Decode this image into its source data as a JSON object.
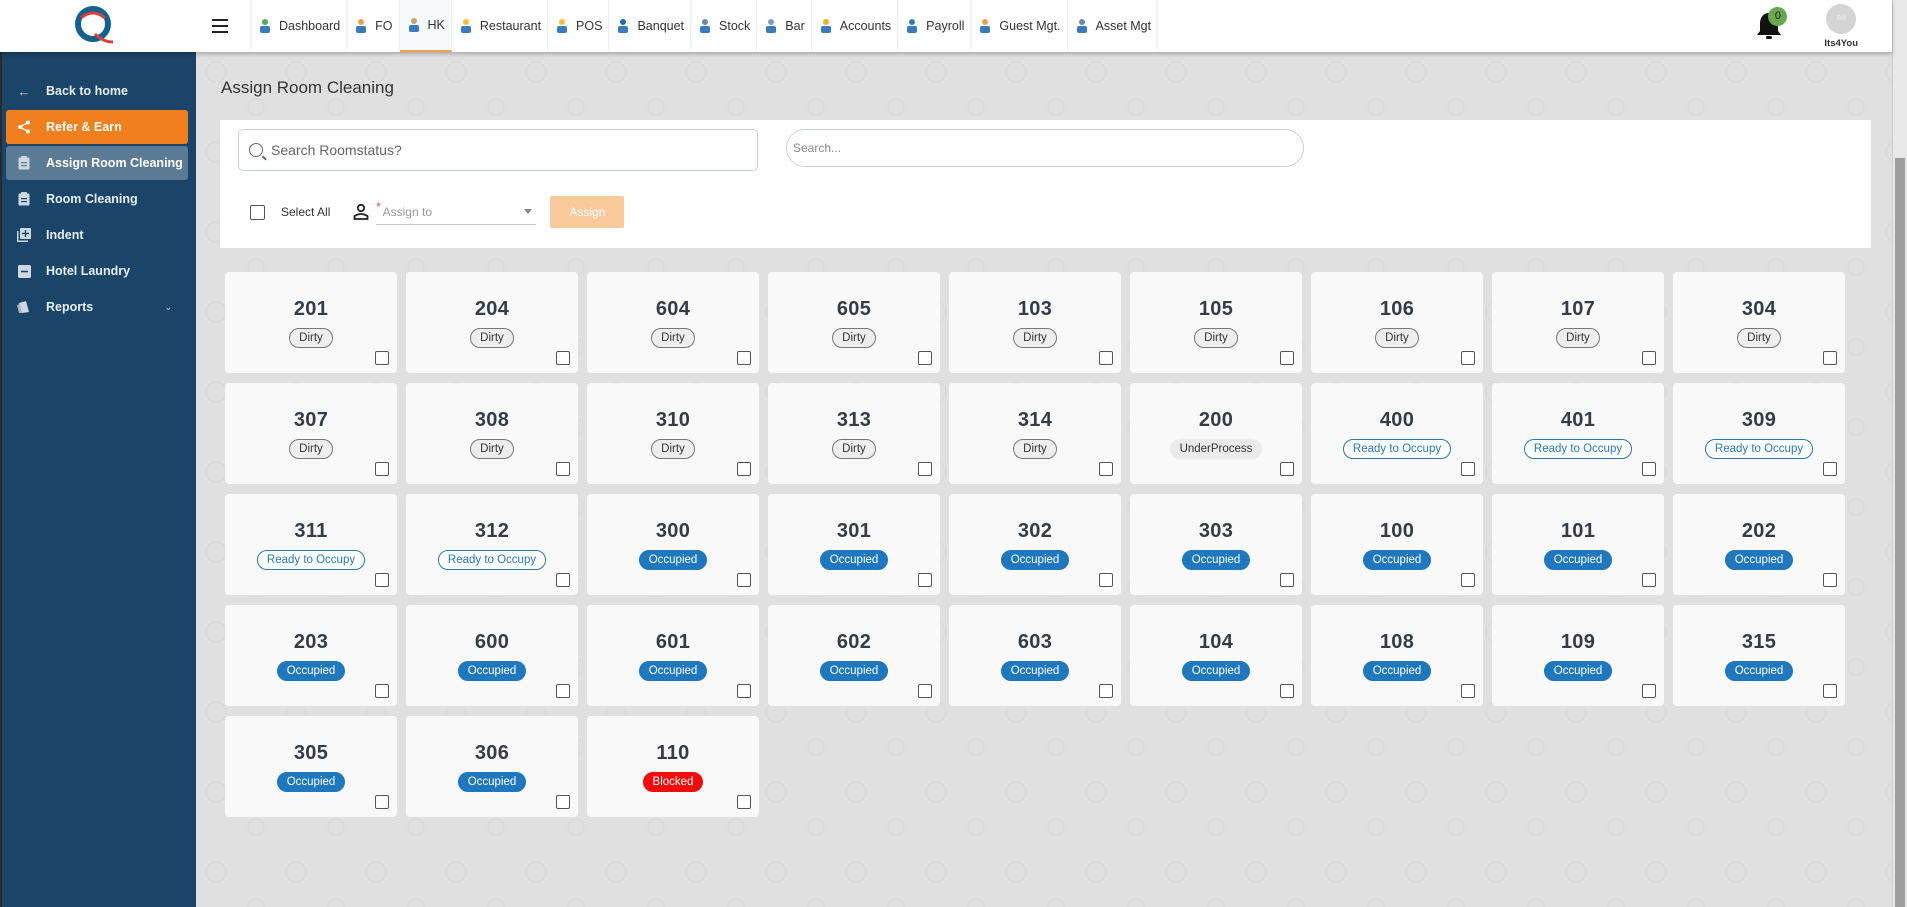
{
  "topbar": {
    "nav": [
      {
        "label": "Dashboard",
        "icon": "dashboard-icon"
      },
      {
        "label": "FO",
        "icon": "front-office-icon"
      },
      {
        "label": "HK",
        "icon": "housekeeping-icon",
        "active": true
      },
      {
        "label": "Restaurant",
        "icon": "restaurant-icon"
      },
      {
        "label": "POS",
        "icon": "pos-icon"
      },
      {
        "label": "Banquet",
        "icon": "banquet-icon"
      },
      {
        "label": "Stock",
        "icon": "stock-icon"
      },
      {
        "label": "Bar",
        "icon": "bar-icon"
      },
      {
        "label": "Accounts",
        "icon": "accounts-icon"
      },
      {
        "label": "Payroll",
        "icon": "payroll-icon"
      },
      {
        "label": "Guest Mgt.",
        "icon": "guest-mgt-icon"
      },
      {
        "label": "Asset Mgt",
        "icon": "asset-mgt-icon"
      }
    ],
    "notification_count": "0",
    "user_name": "Its4You",
    "avatar_text": "Bill"
  },
  "sidebar": {
    "items": [
      {
        "label": "Back to home",
        "icon": "arrow-left-icon"
      },
      {
        "label": "Refer & Earn",
        "icon": "share-icon"
      },
      {
        "label": "Assign Room Cleaning",
        "icon": "clipboard-icon"
      },
      {
        "label": "Room Cleaning",
        "icon": "clipboard-icon"
      },
      {
        "label": "Indent",
        "icon": "add-box-icon"
      },
      {
        "label": "Hotel Laundry",
        "icon": "minus-box-icon"
      },
      {
        "label": "Reports",
        "icon": "reports-icon"
      }
    ]
  },
  "main": {
    "title": "Assign Room Cleaning",
    "search_room_placeholder": "Search Roomstatus?",
    "search_placeholder": "Search...",
    "select_all_label": "Select All",
    "assign_to_placeholder": "Assign to",
    "required_mark": "*",
    "assign_button": "Assign"
  },
  "colors": {
    "sidebar_bg": "#1b4568",
    "refer_orange": "#f0801e",
    "occupied_blue": "#1f77bd",
    "blocked_red": "#f20d0d",
    "assign_btn": "#f8c99a"
  },
  "rooms": [
    {
      "number": "201",
      "status": "Dirty"
    },
    {
      "number": "204",
      "status": "Dirty"
    },
    {
      "number": "604",
      "status": "Dirty"
    },
    {
      "number": "605",
      "status": "Dirty"
    },
    {
      "number": "103",
      "status": "Dirty"
    },
    {
      "number": "105",
      "status": "Dirty"
    },
    {
      "number": "106",
      "status": "Dirty"
    },
    {
      "number": "107",
      "status": "Dirty"
    },
    {
      "number": "304",
      "status": "Dirty"
    },
    {
      "number": "307",
      "status": "Dirty"
    },
    {
      "number": "308",
      "status": "Dirty"
    },
    {
      "number": "310",
      "status": "Dirty"
    },
    {
      "number": "313",
      "status": "Dirty"
    },
    {
      "number": "314",
      "status": "Dirty"
    },
    {
      "number": "200",
      "status": "UnderProcess"
    },
    {
      "number": "400",
      "status": "Ready to Occupy"
    },
    {
      "number": "401",
      "status": "Ready to Occupy"
    },
    {
      "number": "309",
      "status": "Ready to Occupy"
    },
    {
      "number": "311",
      "status": "Ready to Occupy"
    },
    {
      "number": "312",
      "status": "Ready to Occupy"
    },
    {
      "number": "300",
      "status": "Occupied"
    },
    {
      "number": "301",
      "status": "Occupied"
    },
    {
      "number": "302",
      "status": "Occupied"
    },
    {
      "number": "303",
      "status": "Occupied"
    },
    {
      "number": "100",
      "status": "Occupied"
    },
    {
      "number": "101",
      "status": "Occupied"
    },
    {
      "number": "202",
      "status": "Occupied"
    },
    {
      "number": "203",
      "status": "Occupied"
    },
    {
      "number": "600",
      "status": "Occupied"
    },
    {
      "number": "601",
      "status": "Occupied"
    },
    {
      "number": "602",
      "status": "Occupied"
    },
    {
      "number": "603",
      "status": "Occupied"
    },
    {
      "number": "104",
      "status": "Occupied"
    },
    {
      "number": "108",
      "status": "Occupied"
    },
    {
      "number": "109",
      "status": "Occupied"
    },
    {
      "number": "315",
      "status": "Occupied"
    },
    {
      "number": "305",
      "status": "Occupied"
    },
    {
      "number": "306",
      "status": "Occupied"
    },
    {
      "number": "110",
      "status": "Blocked"
    }
  ]
}
